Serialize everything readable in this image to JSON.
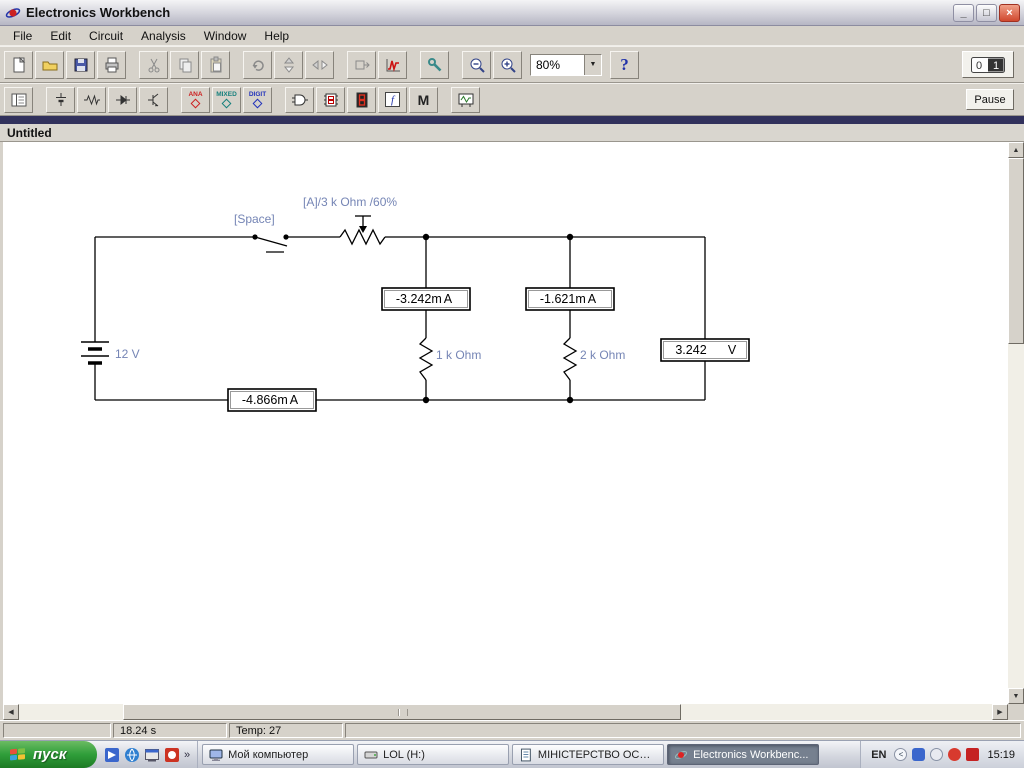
{
  "window": {
    "title": "Electronics Workbench",
    "doc_title": "Untitled"
  },
  "menu": {
    "items": [
      "File",
      "Edit",
      "Circuit",
      "Analysis",
      "Window",
      "Help"
    ]
  },
  "toolbar": {
    "zoom_value": "80%",
    "help": "?",
    "pause": "Pause",
    "power_off": "0",
    "power_on": "1"
  },
  "palette": {
    "ana": "ANA",
    "mixed": "MIXED",
    "digit": "DIGIT",
    "controls": "f",
    "misc": "M"
  },
  "circuit": {
    "battery": {
      "label": "12 V"
    },
    "switch": {
      "label": "[Space]"
    },
    "potentiometer": {
      "label": "[A]/3 k Ohm /60%"
    },
    "resistor1": {
      "label": "1 k Ohm"
    },
    "resistor2": {
      "label": "2 k Ohm"
    },
    "ammeter_branch1": {
      "value": "-3.242m",
      "unit": "A"
    },
    "ammeter_branch2": {
      "value": "-1.621m",
      "unit": "A"
    },
    "ammeter_main": {
      "value": "-4.866m",
      "unit": "A"
    },
    "voltmeter": {
      "value": "3.242",
      "unit": "V"
    }
  },
  "statusbar": {
    "sim_time": "18.24 s",
    "temp": "Temp: 27"
  },
  "taskbar": {
    "start_label": "пуск",
    "overflow": "»",
    "tasks": [
      {
        "label": "Мой компьютер"
      },
      {
        "label": "LOL (H:)"
      },
      {
        "label": "МІНІСТЕРСТВО ОСВІ..."
      },
      {
        "label": "Electronics Workbenc..."
      }
    ],
    "language": "EN",
    "clock": "15:19"
  },
  "icons": {
    "minimize": "_",
    "maximize": "□",
    "close": "×",
    "scroll_up": "▲",
    "scroll_down": "▼",
    "scroll_left": "◀",
    "scroll_right": "▶",
    "dropdown": "▼",
    "tray_collapse": "<"
  },
  "colors": {
    "label-blue": "#7585b5",
    "close-red": "#d0482e",
    "start-green": "#2f9e3a",
    "graph-red": "#cc1111",
    "active-task": "#76808f"
  }
}
